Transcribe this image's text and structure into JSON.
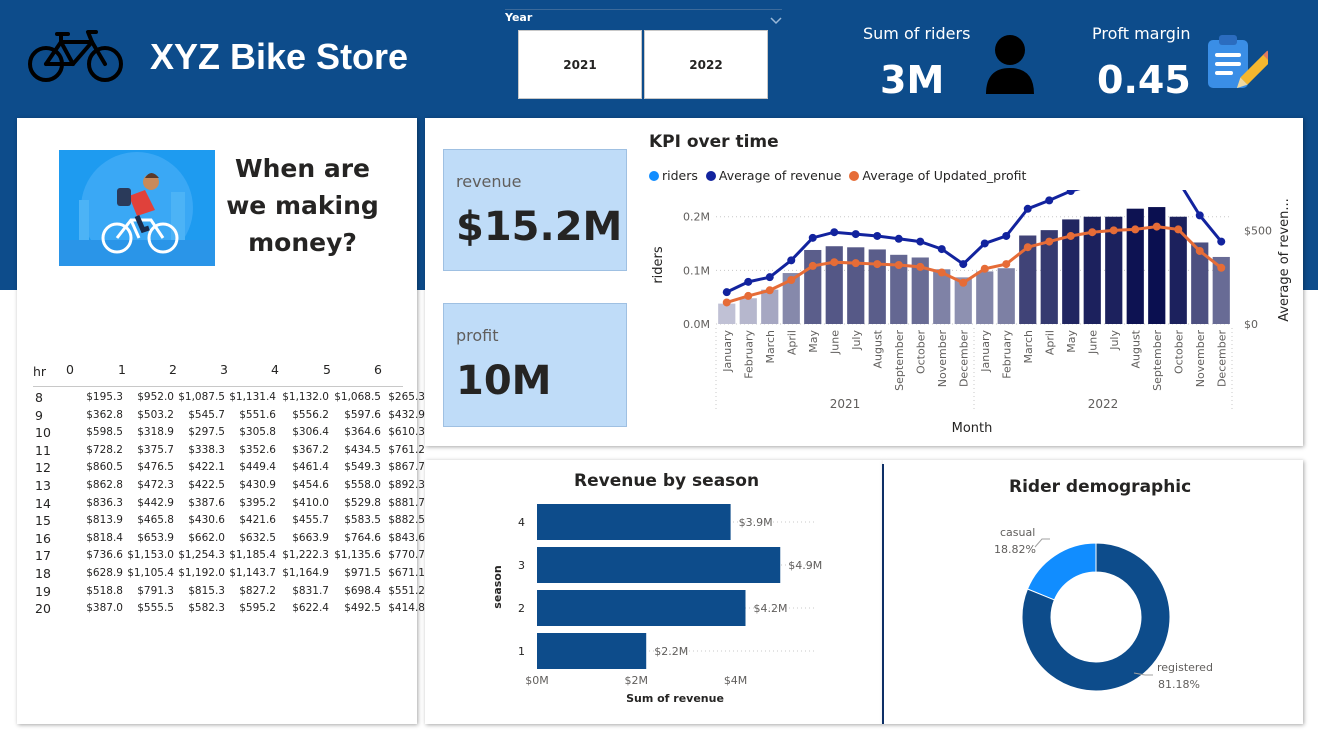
{
  "header": {
    "title": "XYZ Bike Store",
    "logo_icon": "bicycle-icon"
  },
  "slicer": {
    "label": "Year",
    "options": [
      "2021",
      "2022"
    ]
  },
  "kpis": {
    "riders": {
      "title": "Sum of riders",
      "value": "3M",
      "icon": "person-icon"
    },
    "margin": {
      "title": "Proft margin",
      "value": "0.45",
      "icon": "clipboard-icon"
    }
  },
  "left_panel": {
    "question": "When are we making money?",
    "illustration_icon": "cyclist-illustration"
  },
  "matrix": {
    "row_header": "hr",
    "columns": [
      "0",
      "1",
      "2",
      "3",
      "4",
      "5",
      "6"
    ],
    "rows": [
      {
        "hr": "8",
        "values": [
          "$195.3",
          "$952.0",
          "$1,087.5",
          "$1,131.4",
          "$1,132.0",
          "$1,068.5",
          "$265.3"
        ]
      },
      {
        "hr": "9",
        "values": [
          "$362.8",
          "$503.2",
          "$545.7",
          "$551.6",
          "$556.2",
          "$597.6",
          "$432.9"
        ]
      },
      {
        "hr": "10",
        "values": [
          "$598.5",
          "$318.9",
          "$297.5",
          "$305.8",
          "$306.4",
          "$364.6",
          "$610.3"
        ]
      },
      {
        "hr": "11",
        "values": [
          "$728.2",
          "$375.7",
          "$338.3",
          "$352.6",
          "$367.2",
          "$434.5",
          "$761.2"
        ]
      },
      {
        "hr": "12",
        "values": [
          "$860.5",
          "$476.5",
          "$422.1",
          "$449.4",
          "$461.4",
          "$549.3",
          "$867.7"
        ]
      },
      {
        "hr": "13",
        "values": [
          "$862.8",
          "$472.3",
          "$422.5",
          "$430.9",
          "$454.6",
          "$558.0",
          "$892.3"
        ]
      },
      {
        "hr": "14",
        "values": [
          "$836.3",
          "$442.9",
          "$387.6",
          "$395.2",
          "$410.0",
          "$529.8",
          "$881.7"
        ]
      },
      {
        "hr": "15",
        "values": [
          "$813.9",
          "$465.8",
          "$430.6",
          "$421.6",
          "$455.7",
          "$583.5",
          "$882.5"
        ]
      },
      {
        "hr": "16",
        "values": [
          "$818.4",
          "$653.9",
          "$662.0",
          "$632.5",
          "$663.9",
          "$764.6",
          "$843.6"
        ]
      },
      {
        "hr": "17",
        "values": [
          "$736.6",
          "$1,153.0",
          "$1,254.3",
          "$1,185.4",
          "$1,222.3",
          "$1,135.6",
          "$770.7"
        ]
      },
      {
        "hr": "18",
        "values": [
          "$628.9",
          "$1,105.4",
          "$1,192.0",
          "$1,143.7",
          "$1,164.9",
          "$971.5",
          "$671.1"
        ]
      },
      {
        "hr": "19",
        "values": [
          "$518.8",
          "$791.3",
          "$815.3",
          "$827.2",
          "$831.7",
          "$698.4",
          "$551.2"
        ]
      },
      {
        "hr": "20",
        "values": [
          "$387.0",
          "$555.5",
          "$582.3",
          "$595.2",
          "$622.4",
          "$492.5",
          "$414.8"
        ]
      }
    ]
  },
  "revenue_card": {
    "label": "revenue",
    "value": "$15.2M"
  },
  "profit_card": {
    "label": "profit",
    "value": "10M"
  },
  "chart_data": [
    {
      "type": "bar",
      "subtype": "combo-bar-line",
      "title": "KPI over time",
      "legend": [
        "riders",
        "Average of revenue",
        "Average of Updated_profit"
      ],
      "legend_position": "top-left",
      "colors": {
        "riders": "#118dff",
        "revenue": "#12239e",
        "profit": "#e66c37"
      },
      "xlabel": "Month",
      "ylabel": "riders",
      "y2label": "Average of reven...",
      "year_groups": [
        "2021",
        "2022"
      ],
      "categories": [
        "January",
        "February",
        "March",
        "April",
        "May",
        "June",
        "July",
        "August",
        "September",
        "October",
        "November",
        "December",
        "January",
        "February",
        "March",
        "April",
        "May",
        "June",
        "July",
        "August",
        "September",
        "October",
        "November",
        "December"
      ],
      "y_ticks": [
        "0.0M",
        "0.1M",
        "0.2M"
      ],
      "ylim": [
        0,
        0.22
      ],
      "y2_ticks": [
        "$0",
        "$500"
      ],
      "y2lim": [
        0,
        630
      ],
      "series": [
        {
          "name": "riders",
          "values": [
            0.038,
            0.048,
            0.064,
            0.095,
            0.138,
            0.145,
            0.143,
            0.139,
            0.129,
            0.124,
            0.102,
            0.087,
            0.098,
            0.104,
            0.165,
            0.175,
            0.195,
            0.2,
            0.2,
            0.215,
            0.218,
            0.2,
            0.152,
            0.125
          ]
        },
        {
          "name": "Average of revenue",
          "values": [
            170,
            225,
            250,
            340,
            460,
            490,
            480,
            470,
            455,
            440,
            400,
            320,
            430,
            470,
            615,
            660,
            710,
            740,
            755,
            770,
            800,
            765,
            580,
            440
          ]
        },
        {
          "name": "Average of Updated_profit",
          "values": [
            115,
            150,
            180,
            235,
            310,
            330,
            325,
            320,
            315,
            305,
            275,
            220,
            295,
            320,
            410,
            440,
            470,
            490,
            500,
            505,
            520,
            505,
            390,
            300
          ]
        }
      ]
    },
    {
      "type": "bar",
      "orientation": "horizontal",
      "title": "Revenue by season",
      "xlabel": "Sum of revenue",
      "ylabel": "season",
      "categories": [
        "4",
        "3",
        "2",
        "1"
      ],
      "values": [
        3.9,
        4.9,
        4.2,
        2.2
      ],
      "data_labels": [
        "$3.9M",
        "$4.9M",
        "$4.2M",
        "$2.2M"
      ],
      "x_ticks": [
        "$0M",
        "$2M",
        "$4M"
      ],
      "xlim": [
        0,
        5.6
      ],
      "color": "#0d4c8b"
    },
    {
      "type": "pie",
      "subtype": "donut",
      "title": "Rider demographic",
      "categories": [
        "casual",
        "registered"
      ],
      "values": [
        18.82,
        81.18
      ],
      "labels": [
        "18.82%",
        "81.18%"
      ],
      "colors": [
        "#118dff",
        "#0d4c8b"
      ]
    }
  ]
}
